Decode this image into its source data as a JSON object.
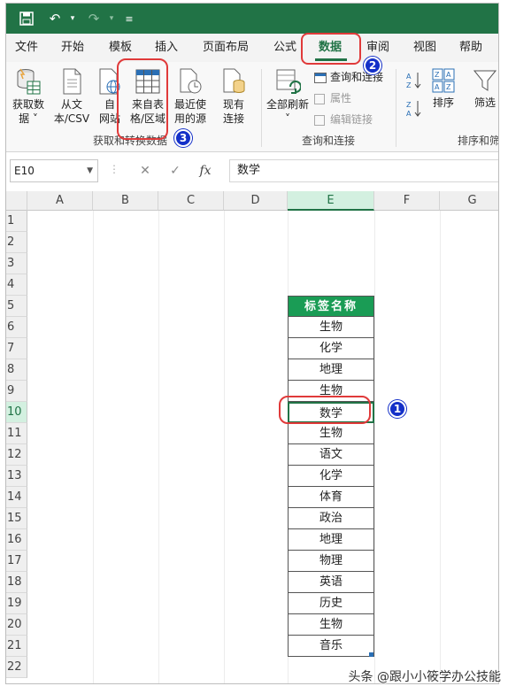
{
  "tabs": [
    "文件",
    "开始",
    "模板",
    "插入",
    "页面布局",
    "公式",
    "数据",
    "审阅",
    "视图",
    "帮助"
  ],
  "ribbon": {
    "get_data": "获取数\n据 ˅",
    "from_text": "从文\n本/CSV",
    "from_web": "自\n网站",
    "from_table": "来自表\n格/区域",
    "recent_sources": "最近使\n用的源",
    "existing_connections": "现有\n连接",
    "refresh_all": "全部刷新\n˅",
    "queries_connections": "查询和连接",
    "properties": "属性",
    "edit_links": "编辑链接",
    "sort": "排序",
    "filter": "筛选",
    "group_get_transform": "获取和转换数据",
    "group_queries": "查询和连接",
    "group_sort_filter": "排序和筛"
  },
  "formula_bar": {
    "name_box": "E10",
    "cancel": "✕",
    "enter": "✓",
    "fx": "fx",
    "value": "数学"
  },
  "columns": [
    "A",
    "B",
    "C",
    "D",
    "E",
    "F",
    "G"
  ],
  "rows": [
    "1",
    "2",
    "3",
    "4",
    "5",
    "6",
    "7",
    "8",
    "9",
    "10",
    "11",
    "12",
    "13",
    "14",
    "15",
    "16",
    "17",
    "18",
    "19",
    "20",
    "21",
    "22"
  ],
  "table": {
    "header": "标签名称",
    "items": [
      "生物",
      "化学",
      "地理",
      "生物",
      "数学",
      "生物",
      "语文",
      "化学",
      "体育",
      "政治",
      "地理",
      "物理",
      "英语",
      "历史",
      "生物",
      "音乐"
    ]
  },
  "badges": [
    "1",
    "2",
    "3"
  ],
  "watermark": "头条 @跟小小筱学办公技能",
  "colors": {
    "accent": "#217346",
    "header_fill": "#1a9c55",
    "callout": "#e03a3a",
    "badge": "#1430c8"
  }
}
